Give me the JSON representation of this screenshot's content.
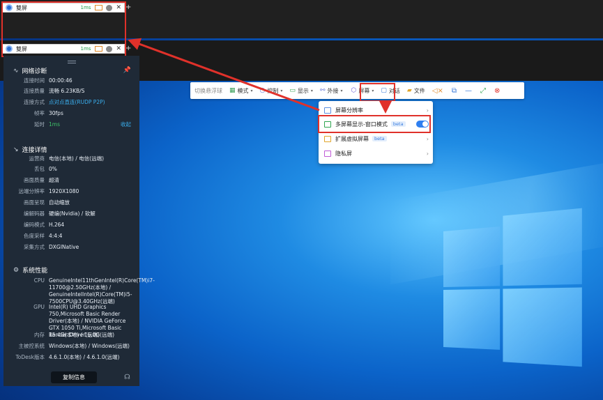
{
  "tab": {
    "name": "雙屏",
    "latency": "1ms"
  },
  "panel": {
    "network_title": "网络诊断",
    "network_rows": [
      {
        "k": "连接时间",
        "v": "00:00:46"
      },
      {
        "k": "连接质量",
        "v": "流畅 6.23KB/S"
      },
      {
        "k": "连接方式",
        "v": "点对点直连(RUDP P2P)"
      },
      {
        "k": "帧率",
        "v": "30fps"
      },
      {
        "k": "延时",
        "v": "1ms",
        "tail": "收起"
      }
    ],
    "details_title": "连接详情",
    "details_rows": [
      {
        "k": "运营商",
        "v": "电信(本地) / 电信(远端)"
      },
      {
        "k": "丢包",
        "v": "0%"
      },
      {
        "k": "画面质量",
        "v": "超清"
      },
      {
        "k": "远端分辨率",
        "v": "1920X1080"
      },
      {
        "k": "画面呈现",
        "v": "自动缩放"
      },
      {
        "k": "编解码器",
        "v": "硬编(Nvidia) / 软解"
      },
      {
        "k": "编码模式",
        "v": "H.264"
      },
      {
        "k": "色度采样",
        "v": "4:4:4"
      },
      {
        "k": "采集方式",
        "v": "DXGINative"
      }
    ],
    "perf_title": "系统性能",
    "perf_rows": [
      {
        "k": "CPU",
        "v": "GenuineIntel11thGenIntel(R)Core(TM)i7-11700@2.50GHz(本地) / GenuineIntelIntel(R)Core(TM)i5-7500CPU@3.40GHz(远端)"
      },
      {
        "k": "GPU",
        "v": "Intel(R) UHD Graphics 750,Microsoft Basic Render Driver(本地) / NVIDIA GeForce GTX 1050 Ti,Microsoft Basic Render Driver(远端)"
      },
      {
        "k": "内存",
        "v": "15.4G(本地) / 16.0G(远端)"
      },
      {
        "k": "主被控系统",
        "v": "Windows(本地) / Windows(远端)"
      },
      {
        "k": "ToDesk版本",
        "v": "4.6.1.0(本地) / 4.6.1.0(远端)"
      }
    ],
    "copy_label": "复制信息"
  },
  "toolbar": {
    "switch_label": "切换悬浮球",
    "mode": "模式",
    "control": "控制",
    "display": "显示",
    "peripheral": "外接",
    "screen": "屏幕",
    "chat": "对话",
    "file": "文件"
  },
  "menu": {
    "items": [
      {
        "label": "屏幕分辨率"
      },
      {
        "label": "多屏幕显示-窗口模式",
        "badge": "beta"
      },
      {
        "label": "扩展虚拟屏幕",
        "badge": "beta"
      },
      {
        "label": "隐私屏"
      }
    ]
  },
  "colors": {
    "highlight": "#e0312a",
    "accent": "#3ab0f0",
    "toggle_on": "#2f7ff0"
  }
}
